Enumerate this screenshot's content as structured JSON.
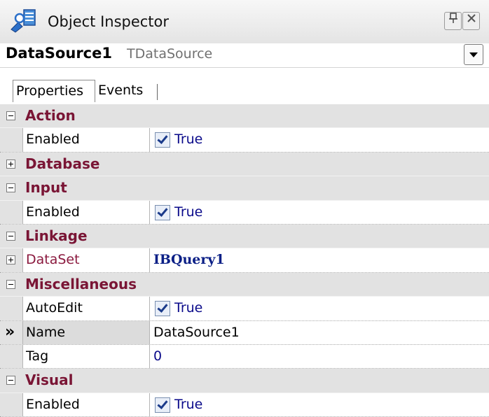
{
  "window": {
    "title": "Object Inspector",
    "pin_icon": "pin-icon",
    "close_icon": "close-icon"
  },
  "object_selector": {
    "name": "DataSource1",
    "type": "TDataSource"
  },
  "tabs": [
    {
      "label": "Properties",
      "active": true
    },
    {
      "label": "Events",
      "active": false
    }
  ],
  "grid": {
    "categories": [
      {
        "label": "Action",
        "expanded": true
      },
      {
        "label": "Database",
        "expanded": false
      },
      {
        "label": "Input",
        "expanded": true
      },
      {
        "label": "Linkage",
        "expanded": true
      },
      {
        "label": "Miscellaneous",
        "expanded": true
      },
      {
        "label": "Visual",
        "expanded": true
      }
    ],
    "action_enabled": {
      "name": "Enabled",
      "value": "True",
      "checked": true
    },
    "input_enabled": {
      "name": "Enabled",
      "value": "True",
      "checked": true
    },
    "linkage_dataset": {
      "name": "DataSet",
      "value": "IBQuery1"
    },
    "misc_autoedit": {
      "name": "AutoEdit",
      "value": "True",
      "checked": true
    },
    "misc_name": {
      "name": "Name",
      "value": "DataSource1",
      "marker": "»"
    },
    "misc_tag": {
      "name": "Tag",
      "value": "0"
    },
    "visual_enabled": {
      "name": "Enabled",
      "value": "True",
      "checked": true
    }
  },
  "colors": {
    "category_text": "#7a1535",
    "value_text": "#0a0a8a",
    "category_bg": "#e2e2e2"
  }
}
